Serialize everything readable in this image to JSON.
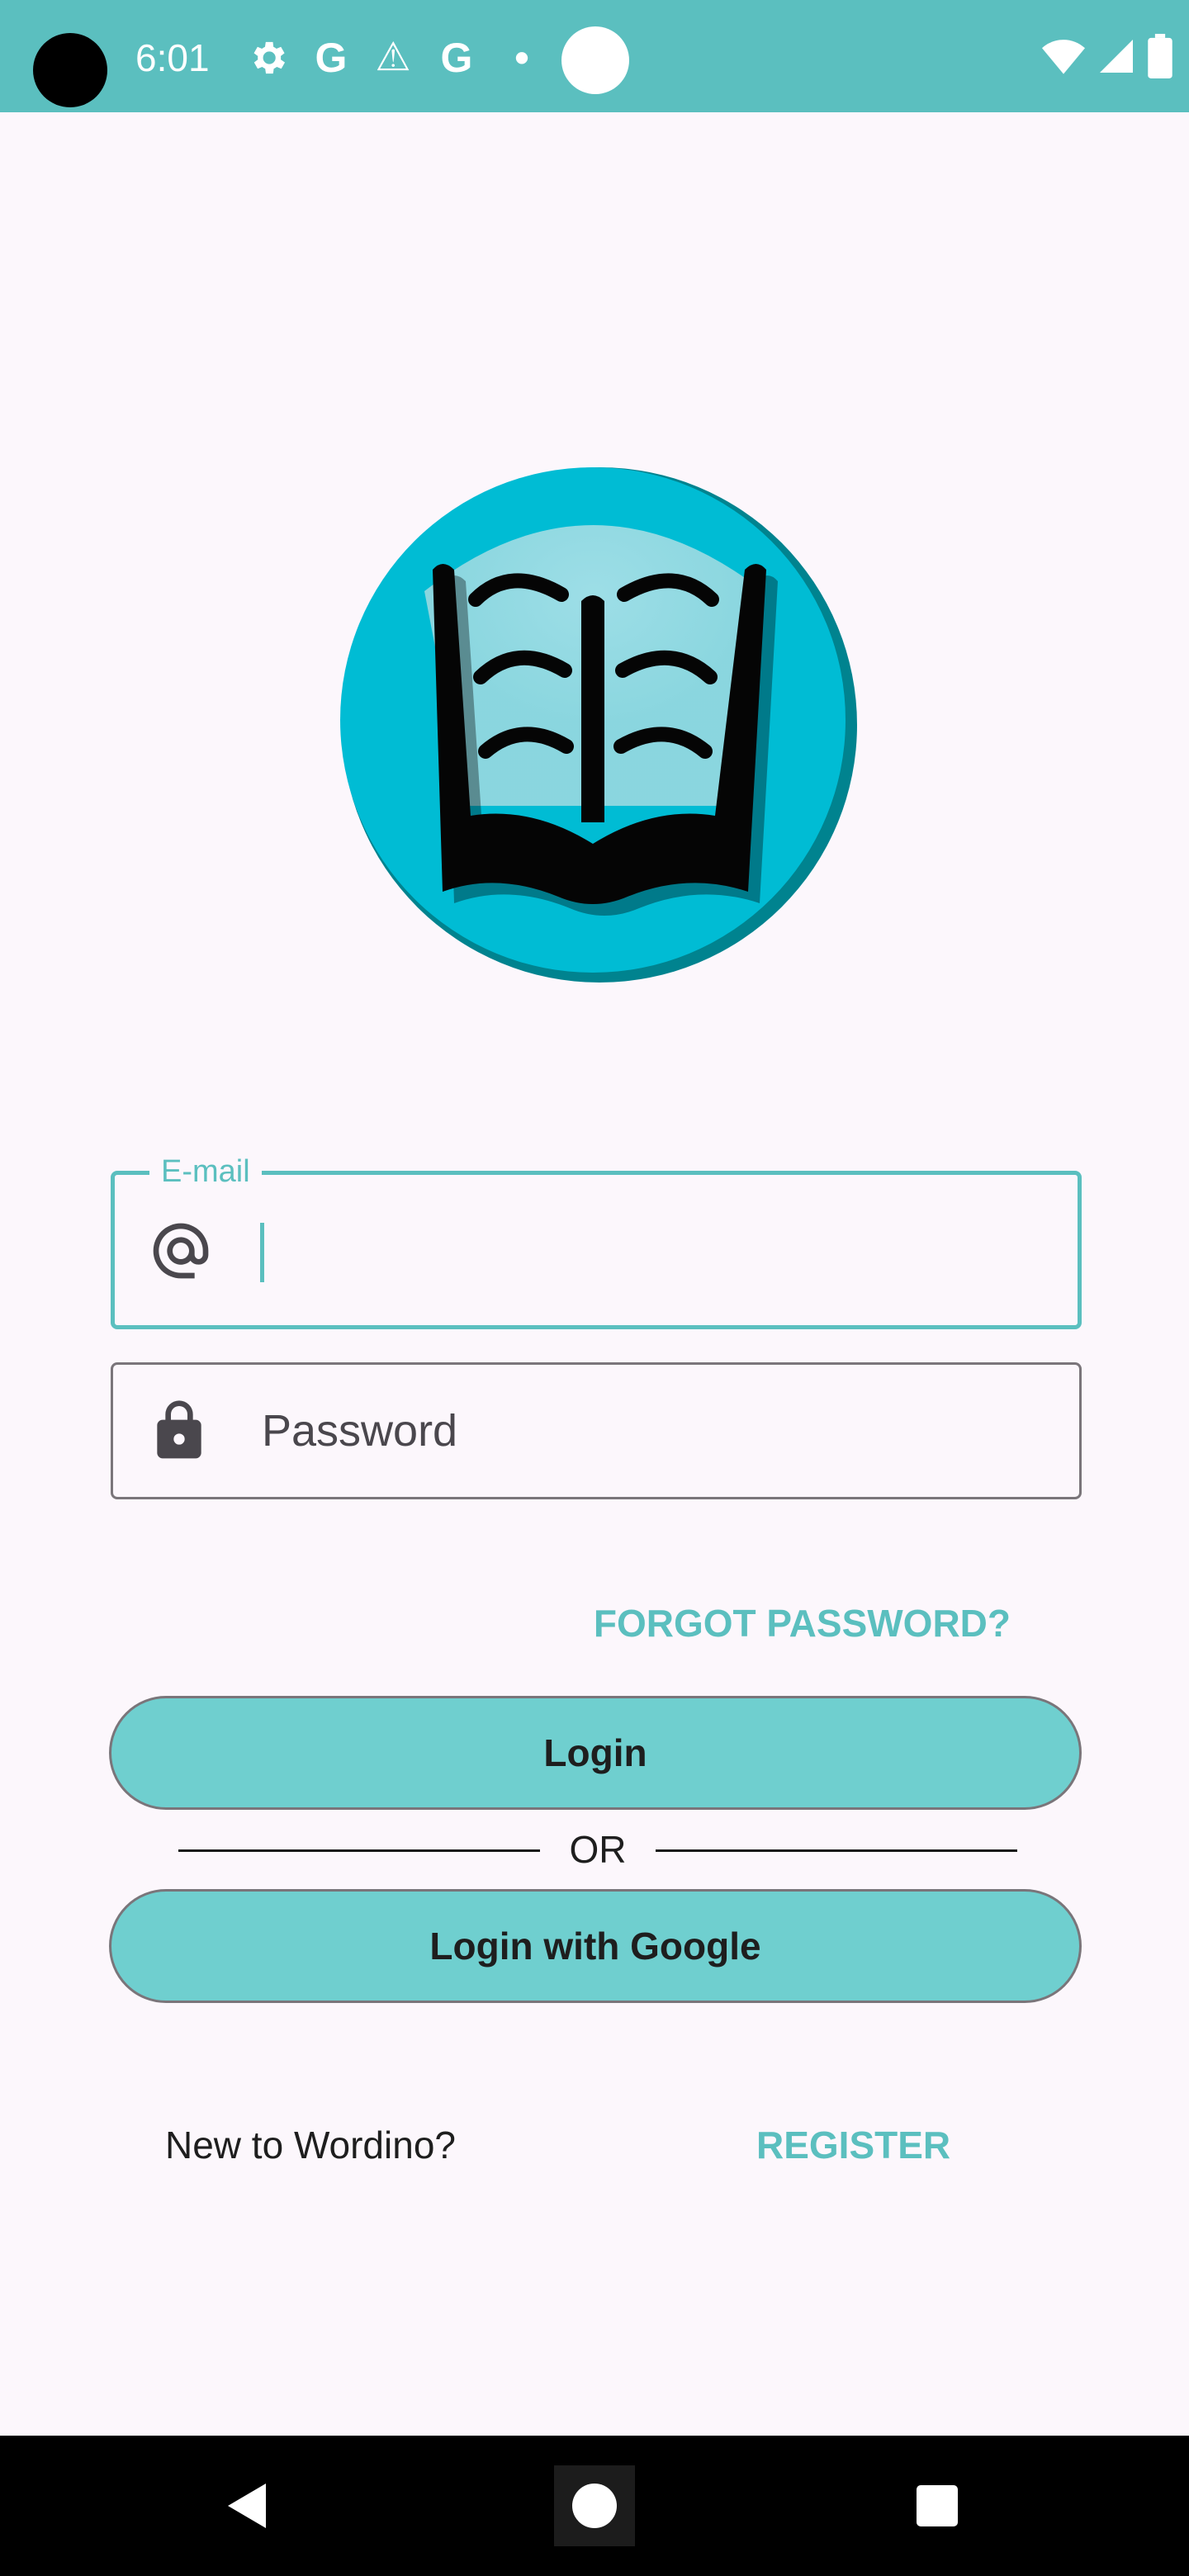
{
  "status_bar": {
    "time": "6:01",
    "left_icons": [
      "settings-icon",
      "google-icon",
      "warning-icon",
      "google-icon",
      "dot-icon",
      "circle-icon"
    ],
    "right_icons": [
      "wifi-icon",
      "signal-icon",
      "battery-icon"
    ],
    "google_glyph": "G",
    "warning_glyph": "⚠",
    "dot_glyph": "•",
    "color": "#5bbfbf"
  },
  "logo": {
    "icon": "open-book-logo",
    "colors": {
      "circle": "#00bcd4",
      "ring": "#00838f",
      "book": "#000000"
    }
  },
  "email_field": {
    "label": "E-mail",
    "value": "",
    "icon": "at-sign-icon",
    "focused": true
  },
  "password_field": {
    "placeholder": "Password",
    "value": "",
    "icon": "lock-icon"
  },
  "forgot_password": {
    "label": "FORGOT PASSWORD?"
  },
  "login_button": {
    "label": "Login"
  },
  "divider": {
    "label": "OR"
  },
  "google_button": {
    "label": "Login with Google"
  },
  "register_row": {
    "prompt": "New to Wordino?",
    "link": "REGISTER"
  },
  "nav_bar": {
    "buttons": [
      "back-icon",
      "home-icon",
      "recents-icon"
    ]
  },
  "colors": {
    "accent": "#5bbfbf",
    "button_fill": "#6fcfcf",
    "background": "#fcf7fc"
  }
}
